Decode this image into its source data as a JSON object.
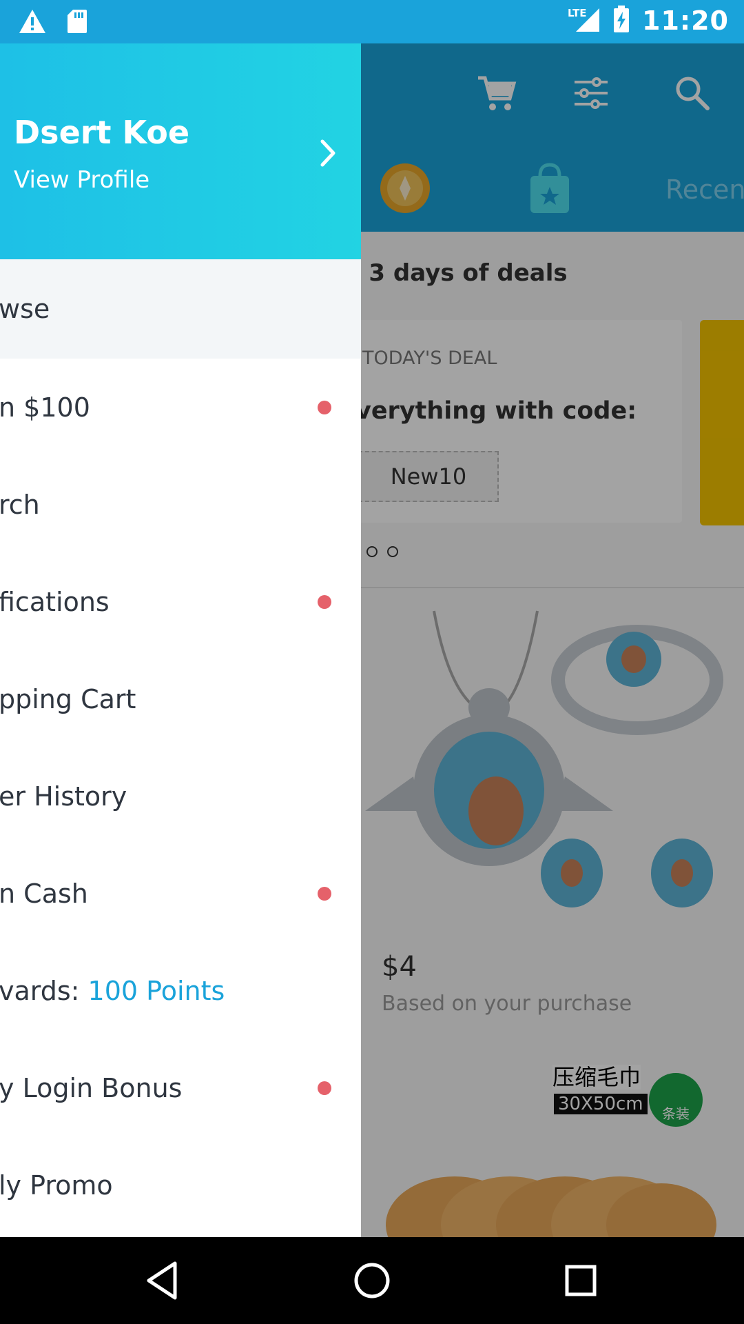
{
  "status_bar": {
    "time": "11:20",
    "network": "LTE",
    "icons": [
      "warning-icon",
      "sd-card-icon",
      "signal-icon",
      "battery-charging-icon"
    ]
  },
  "app": {
    "toolbar_icons": [
      "cart-icon",
      "filter-icon",
      "search-icon"
    ],
    "tabs": {
      "recent_label": "Recen"
    },
    "deals_title": ": 3 days of deals",
    "deal_card": {
      "label": "TODAY'S DEAL",
      "text": "verything with code:",
      "code": "New10"
    },
    "product": {
      "price": "$4",
      "subtitle": "Based on your purchase"
    },
    "towel": {
      "label": "压缩毛巾",
      "size": "30X50cm",
      "badge": "条装"
    }
  },
  "drawer": {
    "profile": {
      "name": "Dsert Koe",
      "link": "View Profile"
    },
    "menu": [
      {
        "label": "wse",
        "dot": false
      },
      {
        "label": "n $100",
        "dot": true
      },
      {
        "label": "rch",
        "dot": false
      },
      {
        "label": "fications",
        "dot": true
      },
      {
        "label": "pping Cart",
        "dot": false
      },
      {
        "label": "er History",
        "dot": false
      },
      {
        "label": "n Cash",
        "dot": true
      },
      {
        "label": "vards: ",
        "accent": "100 Points",
        "dot": false
      },
      {
        "label": "y Login Bonus",
        "dot": true
      },
      {
        "label": "ly Promo",
        "dot": false
      }
    ]
  },
  "nav_bar": [
    "back-icon",
    "home-icon",
    "recents-icon"
  ],
  "colors": {
    "primary": "#1aa3da",
    "header_gradient_end": "#22d3e3",
    "notification_dot": "#e5616a",
    "accent_text": "#1aa3da"
  }
}
